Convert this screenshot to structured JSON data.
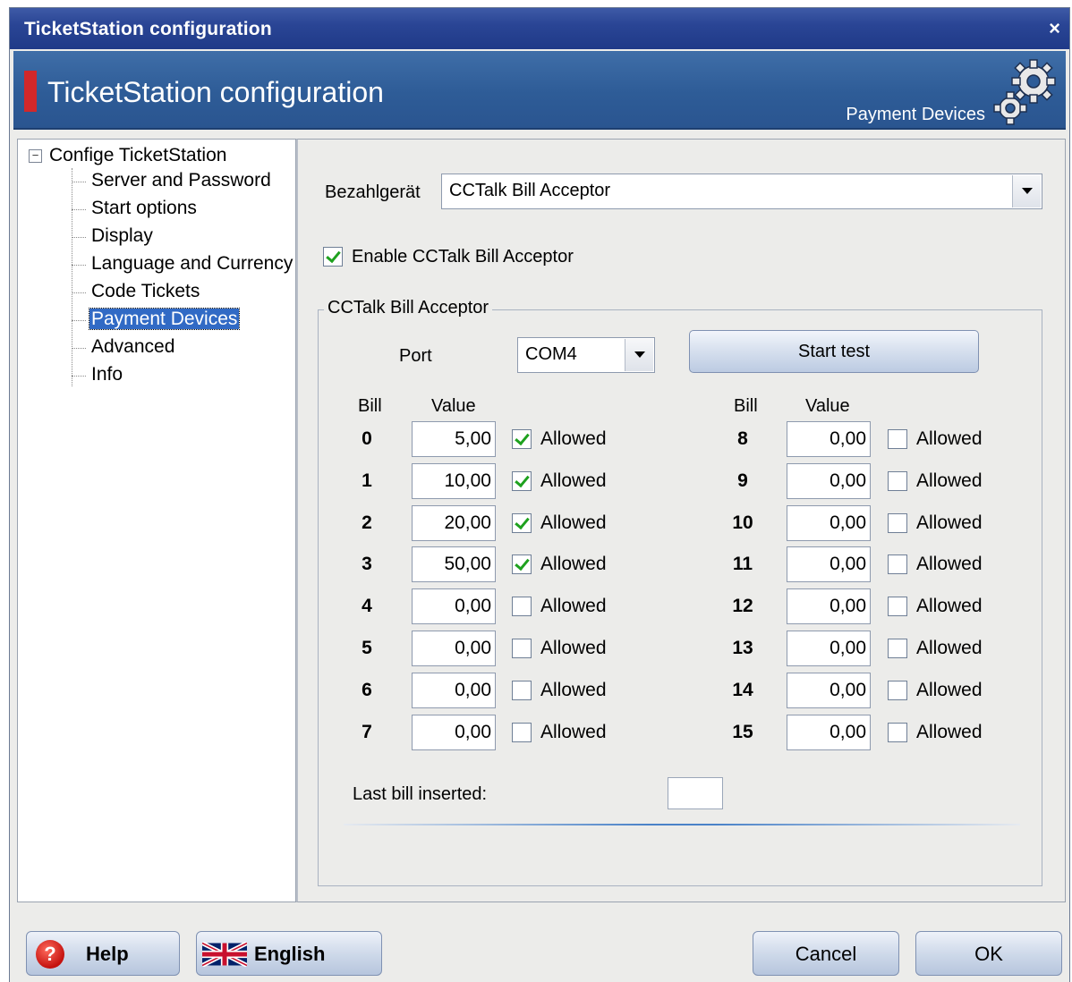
{
  "window": {
    "title": "TicketStation configuration",
    "close_label": "×"
  },
  "banner": {
    "heading": "TicketStation configuration",
    "section": "Payment Devices",
    "icon": "gears-icon",
    "accent": "#d2282a"
  },
  "tree": {
    "root": "Confige TicketStation",
    "expander": "−",
    "items": [
      {
        "label": "Server and Password"
      },
      {
        "label": "Start options"
      },
      {
        "label": "Display"
      },
      {
        "label": "Language and Currency"
      },
      {
        "label": "Code Tickets"
      },
      {
        "label": "Payment Devices",
        "selected": true
      },
      {
        "label": "Advanced"
      },
      {
        "label": "Info"
      }
    ]
  },
  "payment": {
    "device_label": "Bezahlgerät",
    "device_value": "CCTalk Bill Acceptor",
    "enable_label": "Enable CCTalk Bill Acceptor",
    "enable_checked": true,
    "group_title": "CCTalk Bill Acceptor",
    "port_label": "Port",
    "port_value": "COM4",
    "start_test_label": "Start test",
    "bill_header": "Bill",
    "value_header": "Value",
    "allowed_label": "Allowed",
    "bills_left": [
      {
        "bill": "0",
        "value": "5,00",
        "allowed": true
      },
      {
        "bill": "1",
        "value": "10,00",
        "allowed": true
      },
      {
        "bill": "2",
        "value": "20,00",
        "allowed": true
      },
      {
        "bill": "3",
        "value": "50,00",
        "allowed": true
      },
      {
        "bill": "4",
        "value": "0,00",
        "allowed": false
      },
      {
        "bill": "5",
        "value": "0,00",
        "allowed": false
      },
      {
        "bill": "6",
        "value": "0,00",
        "allowed": false
      },
      {
        "bill": "7",
        "value": "0,00",
        "allowed": false
      }
    ],
    "bills_right": [
      {
        "bill": "8",
        "value": "0,00",
        "allowed": false
      },
      {
        "bill": "9",
        "value": "0,00",
        "allowed": false
      },
      {
        "bill": "10",
        "value": "0,00",
        "allowed": false
      },
      {
        "bill": "11",
        "value": "0,00",
        "allowed": false
      },
      {
        "bill": "12",
        "value": "0,00",
        "allowed": false
      },
      {
        "bill": "13",
        "value": "0,00",
        "allowed": false
      },
      {
        "bill": "14",
        "value": "0,00",
        "allowed": false
      },
      {
        "bill": "15",
        "value": "0,00",
        "allowed": false
      }
    ],
    "last_bill_label": "Last bill inserted:",
    "last_bill_value": ""
  },
  "footer": {
    "help_label": "Help",
    "help_icon": "question-icon",
    "language_label": "English",
    "language_icon": "uk-flag-icon",
    "cancel_label": "Cancel",
    "ok_label": "OK"
  }
}
